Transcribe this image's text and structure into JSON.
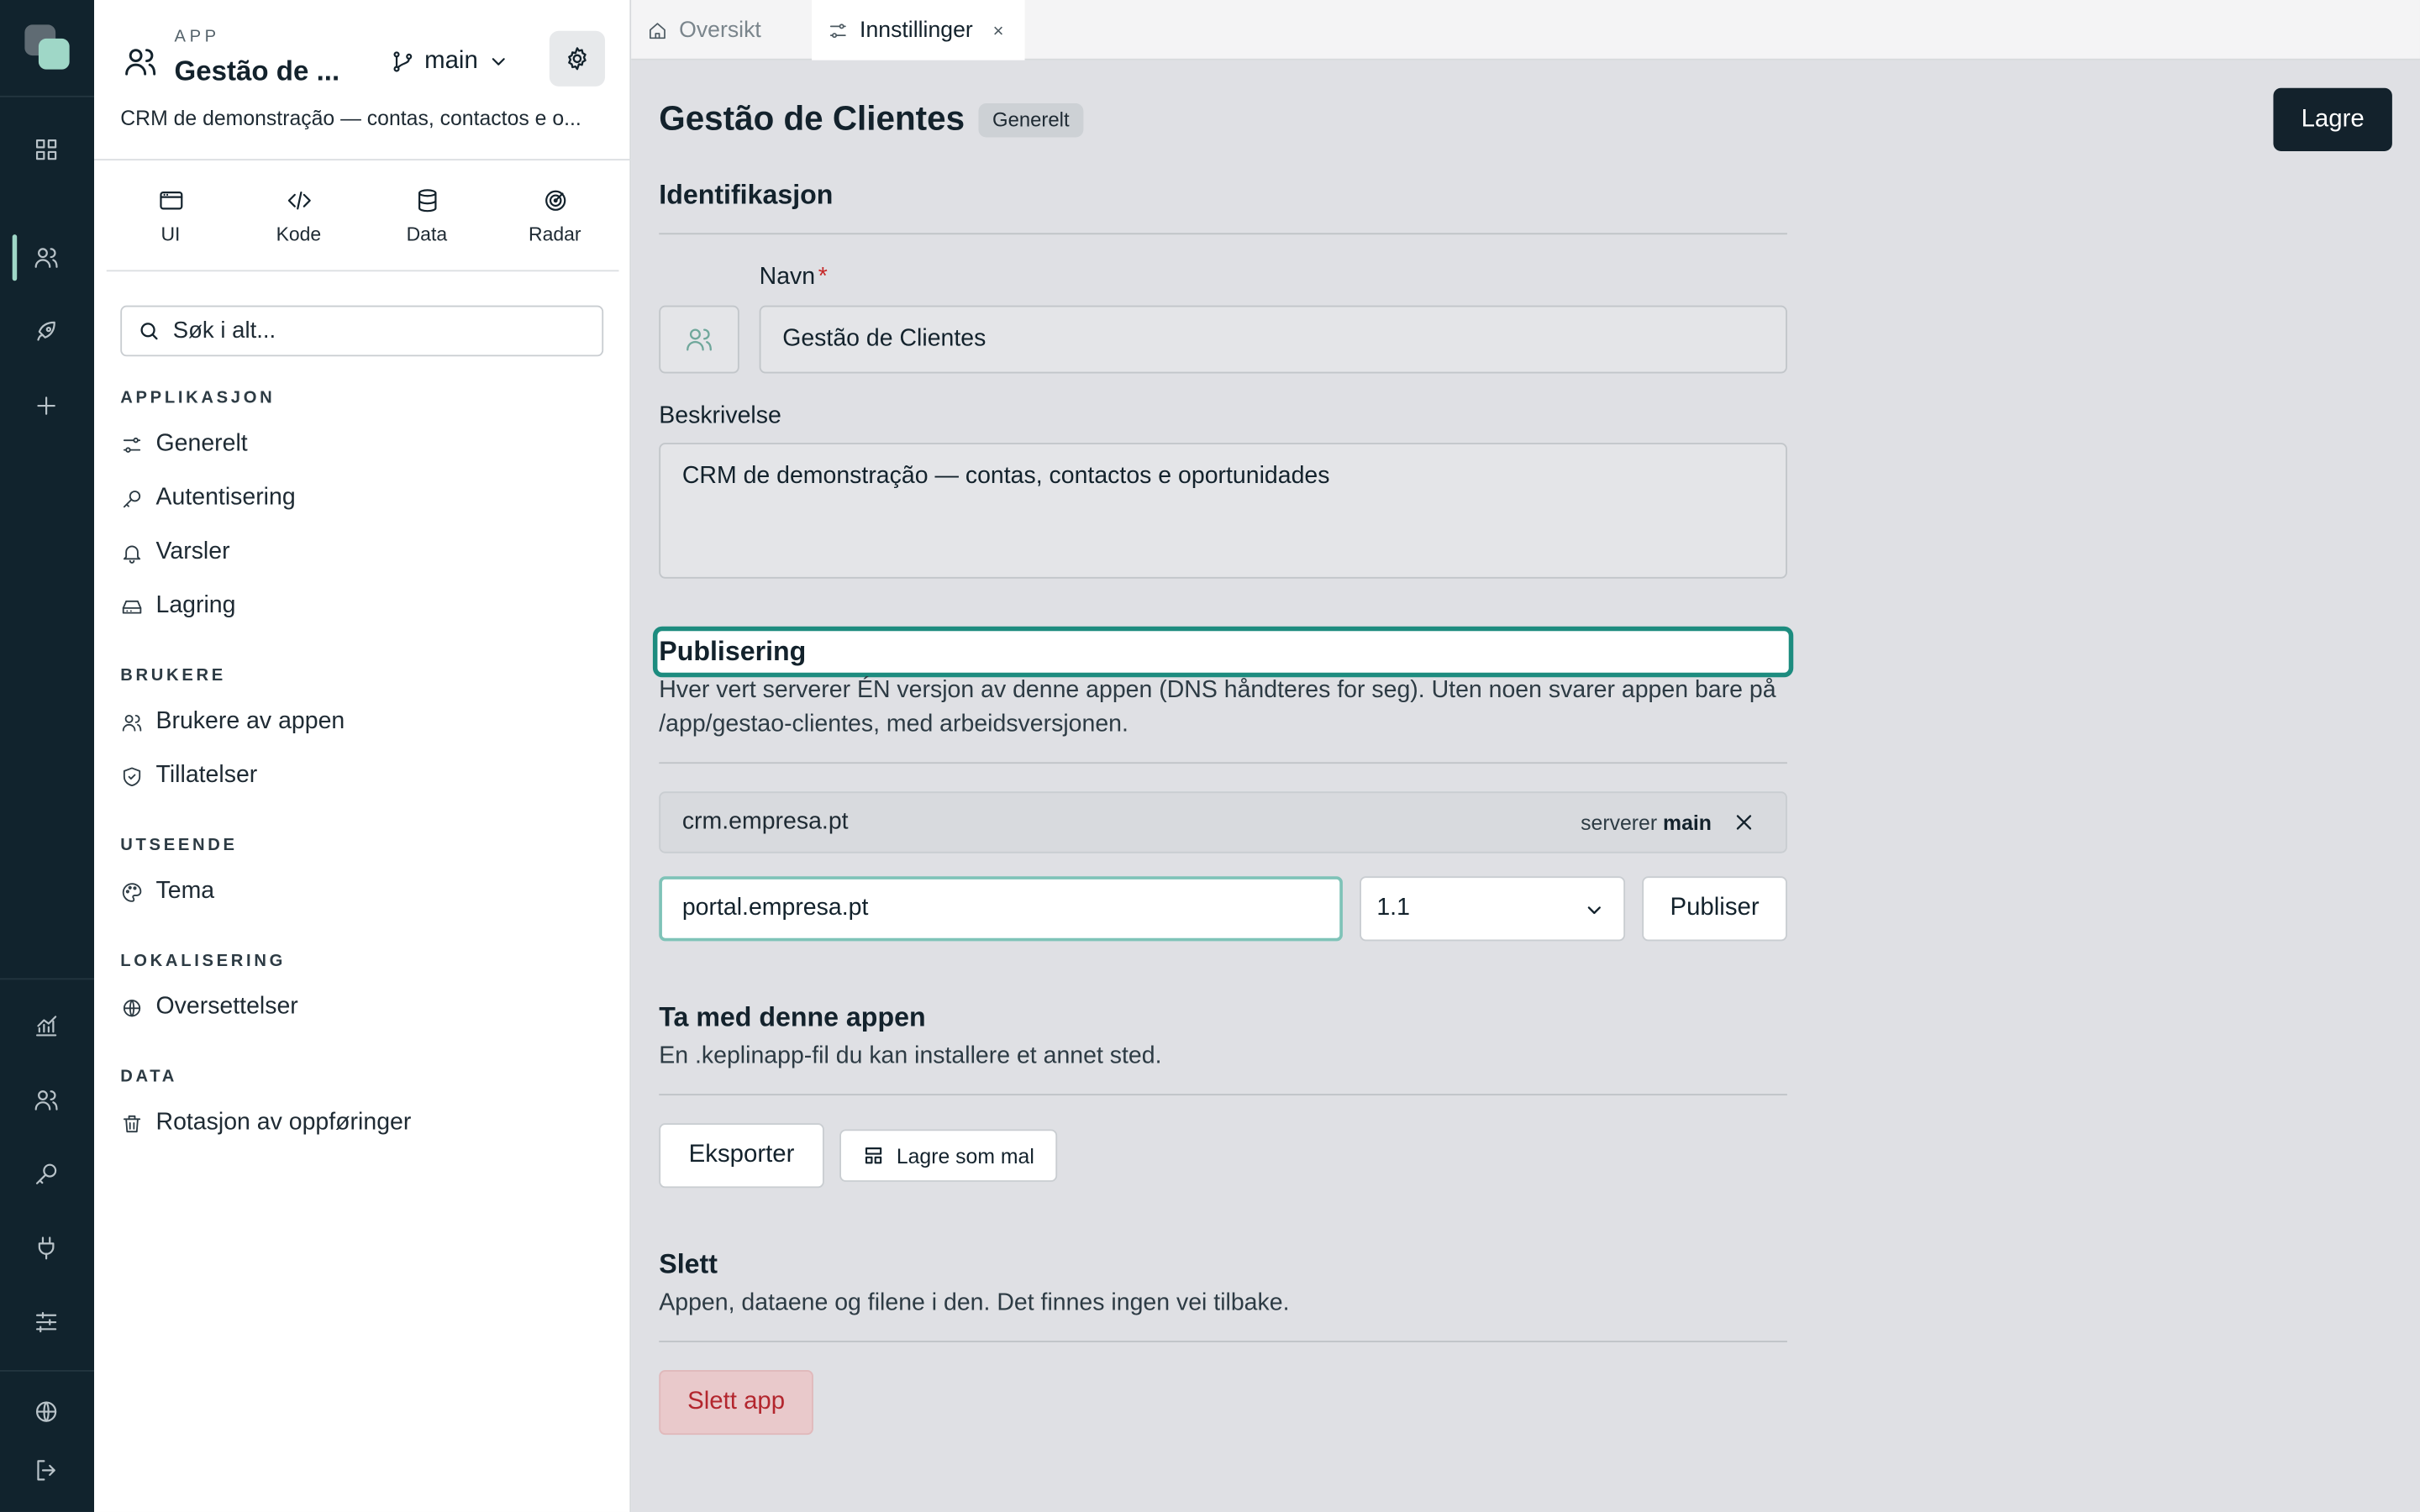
{
  "rail": {
    "icons": [
      "logo",
      "dashboard-icon",
      "users-icon",
      "rocket-icon",
      "plus-icon",
      "analytics-icon",
      "users-icon",
      "key-icon",
      "plug-icon",
      "sliders-icon",
      "globe-icon",
      "logout-icon"
    ],
    "accent": "#9fd7c7"
  },
  "app": {
    "kicker": "APP",
    "name": "Gestão de ...",
    "branch": "main",
    "description": "CRM de demonstração — contas, contactos e o..."
  },
  "modes": [
    {
      "label": "UI",
      "icon": "window-icon"
    },
    {
      "label": "Kode",
      "icon": "code-icon"
    },
    {
      "label": "Data",
      "icon": "database-icon"
    },
    {
      "label": "Radar",
      "icon": "radar-icon"
    }
  ],
  "search": {
    "placeholder": "Søk i alt..."
  },
  "nav": {
    "sections": [
      "APPLIKASJON",
      "BRUKERE",
      "UTSEENDE",
      "LOKALISERING",
      "DATA"
    ],
    "items": [
      "Generelt",
      "Autentisering",
      "Varsler",
      "Lagring",
      "Brukere av appen",
      "Tillatelser",
      "Tema",
      "Oversettelser",
      "Rotasjon av oppføringer"
    ]
  },
  "tabs": [
    {
      "label": "Oversikt",
      "icon": "home-icon"
    },
    {
      "label": "Innstillinger",
      "icon": "settings-sliders-icon",
      "close": "×"
    }
  ],
  "page": {
    "title": "Gestão de Clientes",
    "badge": "Generelt",
    "save": "Lagre"
  },
  "identification": {
    "heading": "Identifikasjon",
    "name_label": "Navn",
    "required_mark": "*",
    "name_value": "Gestão de Clientes",
    "description_label": "Beskrivelse",
    "description_value": "CRM de demonstração — contas, contactos e oportunidades"
  },
  "publishing": {
    "heading": "Publisering",
    "help": "Hver vert serverer ÉN versjon av denne appen (DNS håndteres for seg). Uten noen svarer appen bare på /app/gestao-clientes, med arbeidsversjonen.",
    "existing_domain": "crm.empresa.pt",
    "serving_prefix": "serverer",
    "serving_branch": "main",
    "new_domain_value": "portal.empresa.pt",
    "version_value": "1.1",
    "publish": "Publiser"
  },
  "export": {
    "heading": "Ta med denne appen",
    "help": "En .keplinapp-fil du kan installere et annet sted.",
    "export_btn": "Eksporter",
    "template_btn": "Lagre som mal"
  },
  "delete": {
    "heading": "Slett",
    "help": "Appen, dataene og filene i den. Det finnes ingen vei tilbake.",
    "delete_btn": "Slett app"
  }
}
